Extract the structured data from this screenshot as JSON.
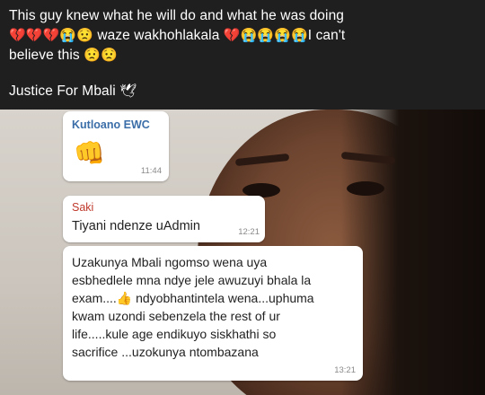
{
  "caption": {
    "line1": "This guy knew what he will do and what he was doing",
    "line2_emoji_a": "💔💔💔😭😟",
    "line2_text": "waze wakhohlakala",
    "line2_emoji_b": "💔😭😭😭😭",
    "line2_tail": "I can't",
    "line3_text": "believe this",
    "line3_emoji": "😟😟",
    "line4_text": "Justice For Mbali",
    "line4_emoji": "🕊"
  },
  "chat": {
    "messages": [
      {
        "sender": "Kutloano EWC",
        "sticker": "👊",
        "time": "11:44"
      },
      {
        "sender": "Saki",
        "text": "Tiyani ndenze uAdmin",
        "time": "12:21"
      },
      {
        "lines": [
          "Uzakunya Mbali ngomso wena uya",
          "esbhedlele mna ndye jele awuzuyi bhala la",
          "exam....👍 ndyobhantintela wena...uphuma",
          "kwam uzondi sebenzela the rest of ur",
          "life.....kule age endikuyo siskhathi so",
          "sacrifice ...uzokunya ntombazana"
        ],
        "time": "13:21"
      }
    ]
  },
  "colors": {
    "header_bg": "#1f1f1f",
    "sender1": "#3b6ea8",
    "sender2": "#c0392b"
  }
}
